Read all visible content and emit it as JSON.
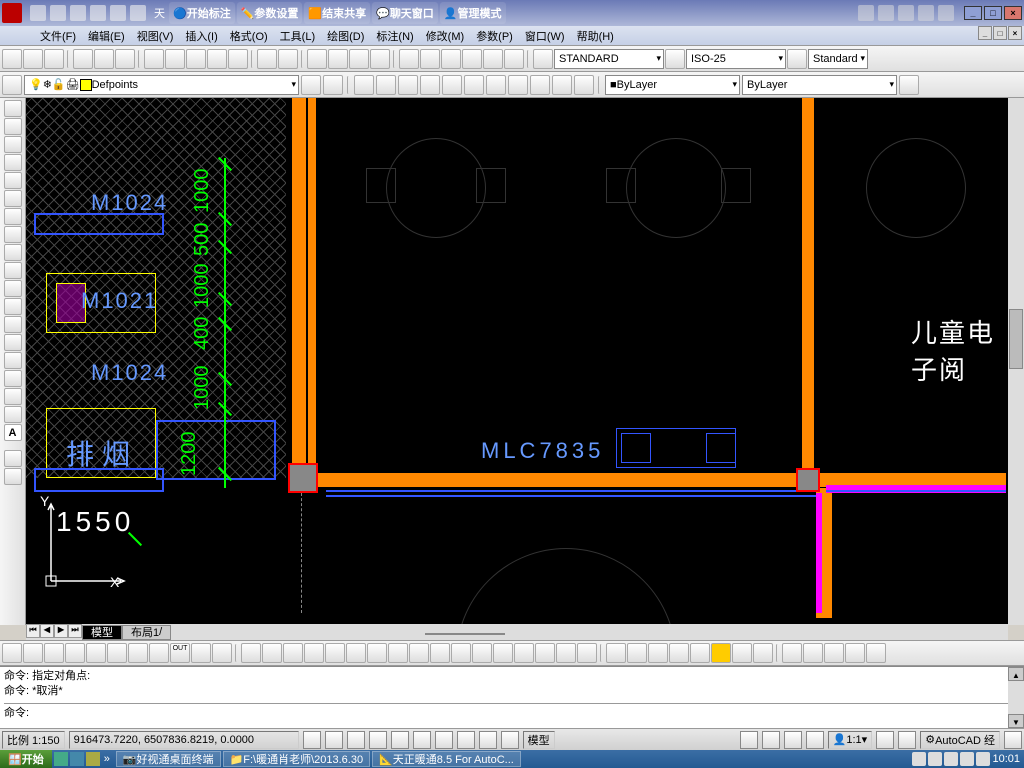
{
  "titlebar": {
    "title_partial": "天"
  },
  "plugin": {
    "b1": "开始标注",
    "b2": "参数设置",
    "b3": "结束共享",
    "b4": "聊天窗口",
    "b5": "管理模式"
  },
  "menu": {
    "file": "文件(F)",
    "edit": "编辑(E)",
    "view": "视图(V)",
    "insert": "插入(I)",
    "format": "格式(O)",
    "tools": "工具(L)",
    "draw": "绘图(D)",
    "dim": "标注(N)",
    "modify": "修改(M)",
    "param": "参数(P)",
    "window": "窗口(W)",
    "help": "帮助(H)"
  },
  "style": {
    "textstyle": "STANDARD",
    "dimstyle": "ISO-25",
    "tablestyle": "Standard"
  },
  "layer": {
    "current": "Defpoints",
    "linetype": "ByLayer",
    "lineweight": "ByLayer"
  },
  "canvas": {
    "mlc": "MLC7835",
    "m1": "M1024",
    "m2": "M1021",
    "m3": "M1024",
    "py": "排烟",
    "room": "儿童电子阅",
    "d1": "1000",
    "d2": "500",
    "d3": "1000",
    "d4": "400",
    "d5": "1000",
    "d6": "1200",
    "c1550": "1550",
    "ux": "X",
    "uy": "Y"
  },
  "tabs": {
    "model": "模型",
    "layout1": "布局1"
  },
  "cmd": {
    "l1": "命令: 指定对角点:",
    "l2": "命令: *取消*",
    "prompt": "命令:"
  },
  "status": {
    "scale": "比例 1:150",
    "coords": "916473.7220, 6507836.8219, 0.0000",
    "mx": "模型",
    "ann": "1:1",
    "ws": "AutoCAD 经"
  },
  "out_label": "OUT",
  "taskbar": {
    "start": "开始",
    "t1": "好视通桌面终端",
    "t2": "F:\\暖通肖老师\\2013.6.30",
    "t3": "天正暖通8.5 For AutoC...",
    "time": "10:01"
  }
}
